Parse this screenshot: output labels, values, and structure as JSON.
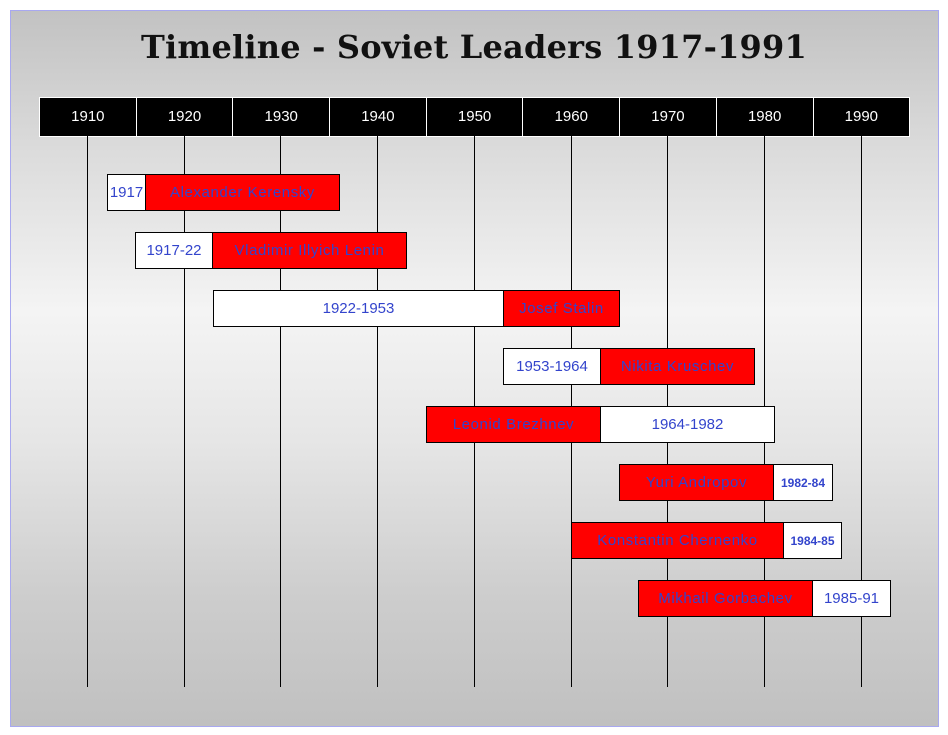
{
  "title": "Timeline - Soviet Leaders 1917-1991",
  "decades": [
    "1910",
    "1920",
    "1930",
    "1940",
    "1950",
    "1960",
    "1970",
    "1980",
    "1990"
  ],
  "leaders": [
    {
      "name": "Alexander Kerensky",
      "years": "1917",
      "start": 1917,
      "end": 1917
    },
    {
      "name": "Vladimir Illyich Lenin",
      "years": "1917-22",
      "start": 1917,
      "end": 1922
    },
    {
      "name": "Josef Stalin",
      "years": "1922-1953",
      "start": 1922,
      "end": 1953
    },
    {
      "name": "Nikita Kruschev",
      "years": "1953-1964",
      "start": 1953,
      "end": 1964
    },
    {
      "name": "Leonid Brezhnev",
      "years": "1964-1982",
      "start": 1964,
      "end": 1982
    },
    {
      "name": "Yuri Andropov",
      "years": "1982-84",
      "start": 1982,
      "end": 1984
    },
    {
      "name": "Konstantin Chernenko",
      "years": "1984-85",
      "start": 1984,
      "end": 1985
    },
    {
      "name": "Mikhail Gorbachev",
      "years": "1985-91",
      "start": 1985,
      "end": 1991
    }
  ],
  "colors": {
    "name_box": "#ff0000",
    "years_box": "#ffffff",
    "label_text": "#3344cc",
    "header_bg": "#000000",
    "header_text": "#ffffff"
  }
}
